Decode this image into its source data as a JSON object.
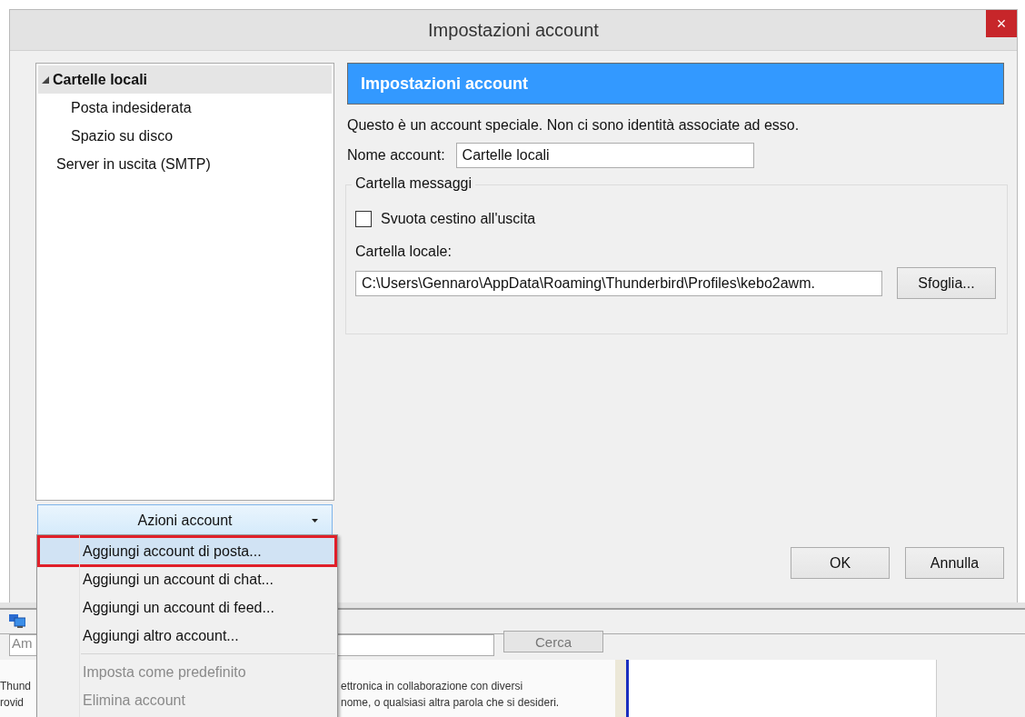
{
  "window": {
    "title": "Impostazioni account",
    "close": "×"
  },
  "tree": [
    {
      "label": "Cartelle locali",
      "expanded": true,
      "selected": true,
      "children": [
        {
          "label": "Posta indesiderata",
          "selected": false
        },
        {
          "label": "Spazio su disco",
          "selected": false
        }
      ]
    },
    {
      "label": "Server in uscita (SMTP)",
      "selected": false
    }
  ],
  "account_actions": {
    "label": "Azioni account",
    "expanded": true,
    "menu": [
      {
        "kind": "item",
        "label": "Aggiungi account di posta...",
        "disabled": false,
        "selected": true
      },
      {
        "kind": "item",
        "label": "Aggiungi un account di chat...",
        "disabled": false,
        "selected": false
      },
      {
        "kind": "item",
        "label": "Aggiungi un account di feed...",
        "disabled": false,
        "selected": false
      },
      {
        "kind": "item",
        "label": "Aggiungi altro account...",
        "disabled": false,
        "selected": false
      },
      {
        "kind": "separator"
      },
      {
        "kind": "item",
        "label": "Imposta come predefinito",
        "disabled": true,
        "selected": false
      },
      {
        "kind": "item",
        "label": "Elimina account",
        "disabled": true,
        "selected": false
      }
    ]
  },
  "panel": {
    "heading": "Impostazioni account",
    "description": "Questo è un account speciale. Non ci sono identità associate ad esso.",
    "name_label": "Nome account:",
    "name_value": "Cartelle locali",
    "group": {
      "legend": "Cartella messaggi",
      "empty_trash": {
        "label": "Svuota cestino all'uscita",
        "checked": false
      },
      "folder_label": "Cartella locale:",
      "folder_path": "C:\\Users\\Gennaro\\AppData\\Roaming\\Thunderbird\\Profiles\\kebo2awm.",
      "browse": "Sfoglia..."
    }
  },
  "buttons": [
    "OK",
    "Annulla"
  ],
  "background_app": {
    "search_value": "Am",
    "search_button": "Cerca",
    "text_lines": [
      {
        "left": "Thund",
        "right": "ettronica in collaborazione con diversi"
      },
      {
        "left": "rovid",
        "right": "nome, o qualsiasi altra parola che si desideri."
      }
    ]
  }
}
